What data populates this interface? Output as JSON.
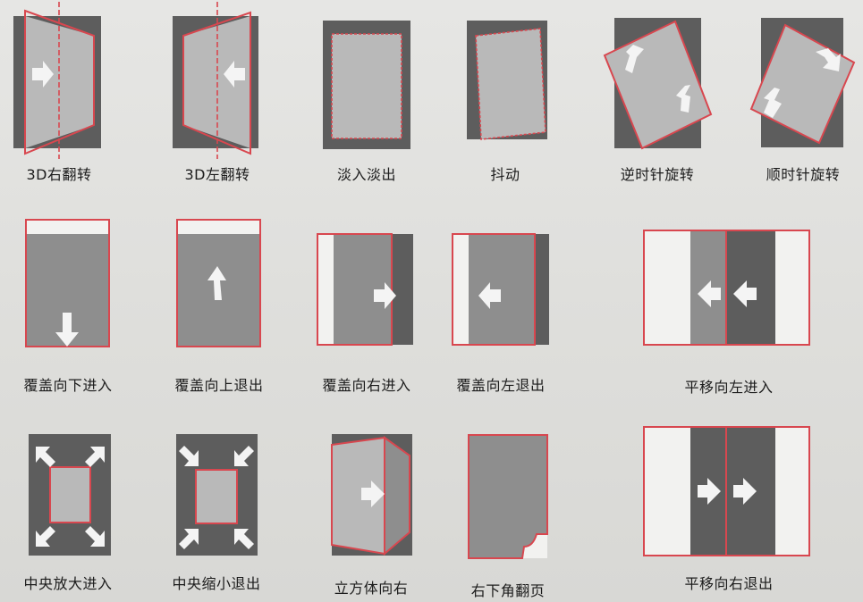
{
  "effects": [
    {
      "id": "3d-flip-right",
      "label": "3D右翻转"
    },
    {
      "id": "3d-flip-left",
      "label": "3D左翻转"
    },
    {
      "id": "fade-in-out",
      "label": "淡入淡出"
    },
    {
      "id": "shake",
      "label": "抖动"
    },
    {
      "id": "rotate-ccw",
      "label": "逆时针旋转"
    },
    {
      "id": "rotate-cw",
      "label": "顺时针旋转"
    },
    {
      "id": "cover-down-in",
      "label": "覆盖向下进入"
    },
    {
      "id": "cover-up-out",
      "label": "覆盖向上退出"
    },
    {
      "id": "cover-right-in",
      "label": "覆盖向右进入"
    },
    {
      "id": "cover-left-out",
      "label": "覆盖向左退出"
    },
    {
      "id": "slide-left-in",
      "label": "平移向左进入"
    },
    {
      "id": "zoom-center-in",
      "label": "中央放大进入"
    },
    {
      "id": "shrink-center-out",
      "label": "中央缩小退出"
    },
    {
      "id": "cube-right",
      "label": "立方体向右"
    },
    {
      "id": "corner-flip-bottom-right",
      "label": "右下角翻页"
    },
    {
      "id": "slide-right-out",
      "label": "平移向右退出"
    }
  ],
  "colors": {
    "accent": "#d8474f",
    "dark": "#5d5d5d",
    "mid": "#8e8e8e",
    "light": "#b9b9b9"
  }
}
